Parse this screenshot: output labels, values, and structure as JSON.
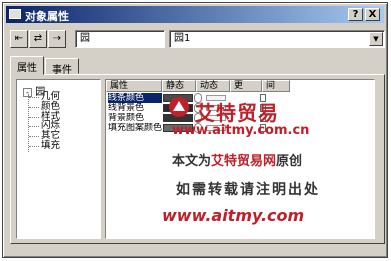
{
  "window": {
    "title": "对象属性"
  },
  "title_buttons": {
    "help": "?",
    "close": "X"
  },
  "toolbar": {
    "tool1": "⇤",
    "tool2": "⇄",
    "tool3": "⇢"
  },
  "name_field": {
    "value": "园"
  },
  "object_select": {
    "value": "园1",
    "arrow": "▼"
  },
  "tabs": [
    {
      "label": "属性"
    },
    {
      "label": "事件"
    }
  ],
  "tree": {
    "root": "园",
    "root_toggle": "-",
    "children": [
      "几何",
      "颜色",
      "样式",
      "闪烁",
      "其它",
      "填充"
    ]
  },
  "grid": {
    "headers": [
      "属性",
      "静态",
      "动态",
      "更",
      "间"
    ],
    "rows": [
      {
        "label": "线条颜色",
        "static_color": "#4a4a4a",
        "selected": true
      },
      {
        "label": "线背景色",
        "static_color": "#2a2a2a",
        "selected": false
      },
      {
        "label": "背景颜色",
        "static_color": "#333333",
        "selected": false
      },
      {
        "label": "填充图案颜色",
        "static_color": "#6a6a6a",
        "selected": false
      }
    ]
  },
  "watermark": {
    "brand": "艾特贸易",
    "url": "www.aitmy.com.cn",
    "line1_prefix": "本文为",
    "line1_brand": "艾特贸易网",
    "line1_suffix": "原创",
    "line2": "如需转载请注明出处",
    "url2": "www.aitmy.com"
  }
}
